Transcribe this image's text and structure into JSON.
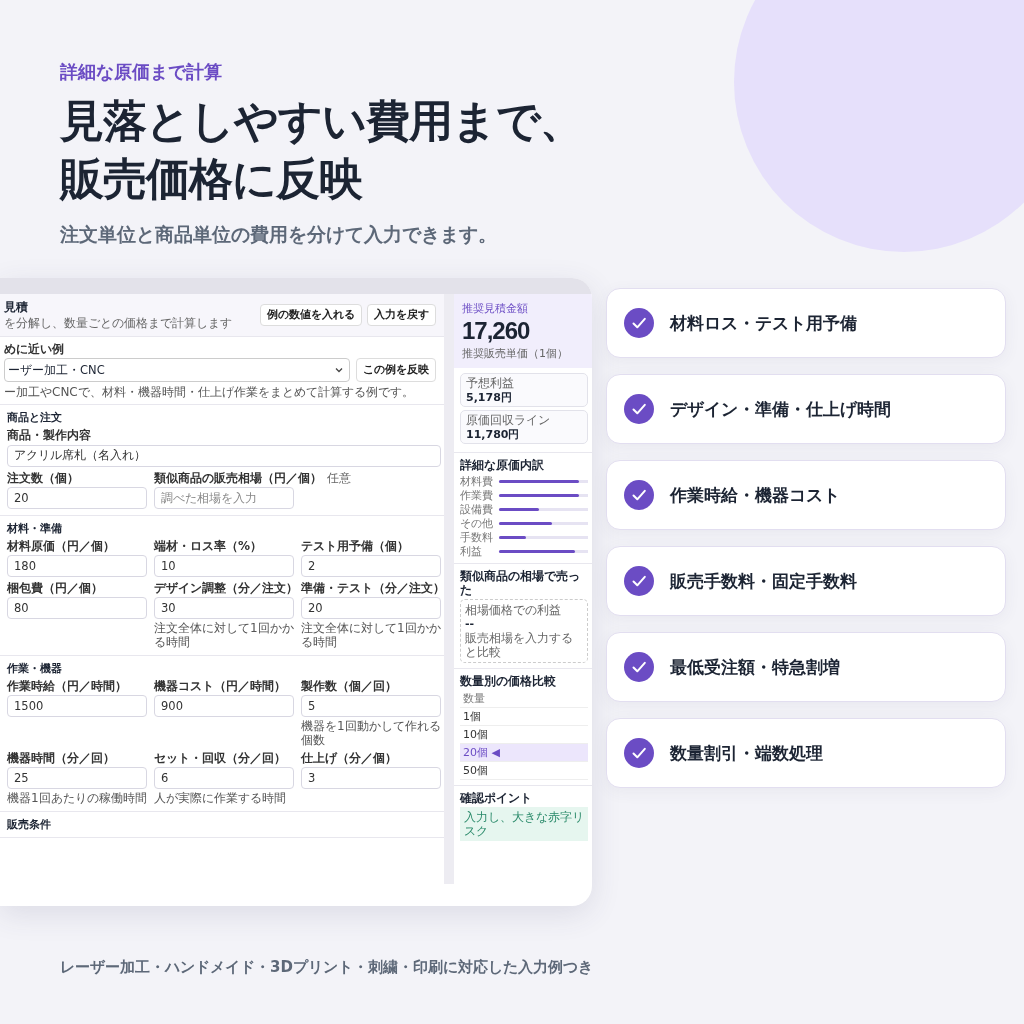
{
  "hero": {
    "eyebrow": "詳細な原価まで計算",
    "title_lines": [
      "見落としやすい費用まで、",
      "販売価格に反映"
    ],
    "subtitle": "注文単位と商品単位の費用を分けて入力できます。"
  },
  "app": {
    "header": {
      "title": "見積",
      "subtitle": "を分解し、数量ごとの価格まで計算します",
      "buttons": [
        "例の数値を入れる",
        "入力を戻す"
      ]
    },
    "example": {
      "label": "めに近い例",
      "select_value": "ーザー加工・CNC",
      "button": "この例を反映",
      "hint": "ー加工やCNCで、材料・機器時間・仕上げ作業をまとめて計算する例です。"
    },
    "sections": [
      {
        "title": "商品と注文",
        "rows": [
          [
            {
              "label": "商品・製作内容",
              "value": "アクリル席札（名入れ）"
            }
          ],
          [
            {
              "label": "注文数（個）",
              "value": "20"
            },
            {
              "label": "類似商品の販売相場（円／個）",
              "optional": "任意",
              "placeholder": "調べた相場を入力"
            }
          ]
        ]
      },
      {
        "title": "材料・準備",
        "rows": [
          [
            {
              "label": "材料原価（円／個）",
              "value": "180"
            },
            {
              "label": "端材・ロス率（%）",
              "value": "10"
            },
            {
              "label": "テスト用予備（個）",
              "value": "2"
            }
          ],
          [
            {
              "label": "梱包費（円／個）",
              "value": "80"
            },
            {
              "label": "デザイン調整（分／注文）",
              "value": "30",
              "note": "注文全体に対して1回かかる時間"
            },
            {
              "label": "準備・テスト（分／注文）",
              "value": "20",
              "note": "注文全体に対して1回かかる時間"
            }
          ]
        ]
      },
      {
        "title": "作業・機器",
        "rows": [
          [
            {
              "label": "作業時給（円／時間）",
              "value": "1500"
            },
            {
              "label": "機器コスト（円／時間）",
              "value": "900"
            },
            {
              "label": "製作数（個／回）",
              "value": "5",
              "note": "機器を1回動かして作れる個数"
            }
          ],
          [
            {
              "label": "機器時間（分／回）",
              "value": "25",
              "note": "機器1回あたりの稼働時間"
            },
            {
              "label": "セット・回収（分／回）",
              "value": "6",
              "note": "人が実際に作業する時間"
            },
            {
              "label": "仕上げ（分／個）",
              "value": "3"
            }
          ]
        ]
      },
      {
        "title": "販売条件"
      }
    ]
  },
  "summary": {
    "label": "推奨見積金額",
    "amount": "17,260",
    "unit_label": "推奨販売単価（1個）",
    "metrics": [
      {
        "label": "予想利益",
        "value": "5,178円"
      },
      {
        "label": "原価回収ライン",
        "value": "11,780円"
      }
    ],
    "breakdown": {
      "title": "詳細な原価内訳",
      "items": [
        {
          "label": "材料費",
          "level": 0.9
        },
        {
          "label": "作業費",
          "level": 0.9
        },
        {
          "label": "設備費",
          "level": 0.45
        },
        {
          "label": "その他",
          "level": 0.6
        },
        {
          "label": "手数料",
          "level": 0.3
        },
        {
          "label": "利益",
          "level": 0.85
        }
      ]
    },
    "market": {
      "title": "類似商品の相場で売った",
      "label": "相場価格での利益",
      "value": "--",
      "hint": "販売相場を入力すると比較"
    },
    "quantity": {
      "title": "数量別の価格比較",
      "header": "数量",
      "rows": [
        {
          "label": "1個",
          "selected": false
        },
        {
          "label": "10個",
          "selected": false
        },
        {
          "label": "20個 ◀",
          "selected": true
        },
        {
          "label": "50個",
          "selected": false
        }
      ]
    },
    "check": {
      "title": "確認ポイント",
      "text": "入力し、大きな赤字リスク"
    }
  },
  "features": [
    {
      "label": "材料ロス・テスト用予備"
    },
    {
      "label": "デザイン・準備・仕上げ時間"
    },
    {
      "label": "作業時給・機器コスト"
    },
    {
      "label": "販売手数料・固定手数料"
    },
    {
      "label": "最低受注額・特急割増"
    },
    {
      "label": "数量割引・端数処理"
    }
  ],
  "footer": "レーザー加工・ハンドメイド・3Dプリント・刺繍・印刷に対応した入力例つき"
}
